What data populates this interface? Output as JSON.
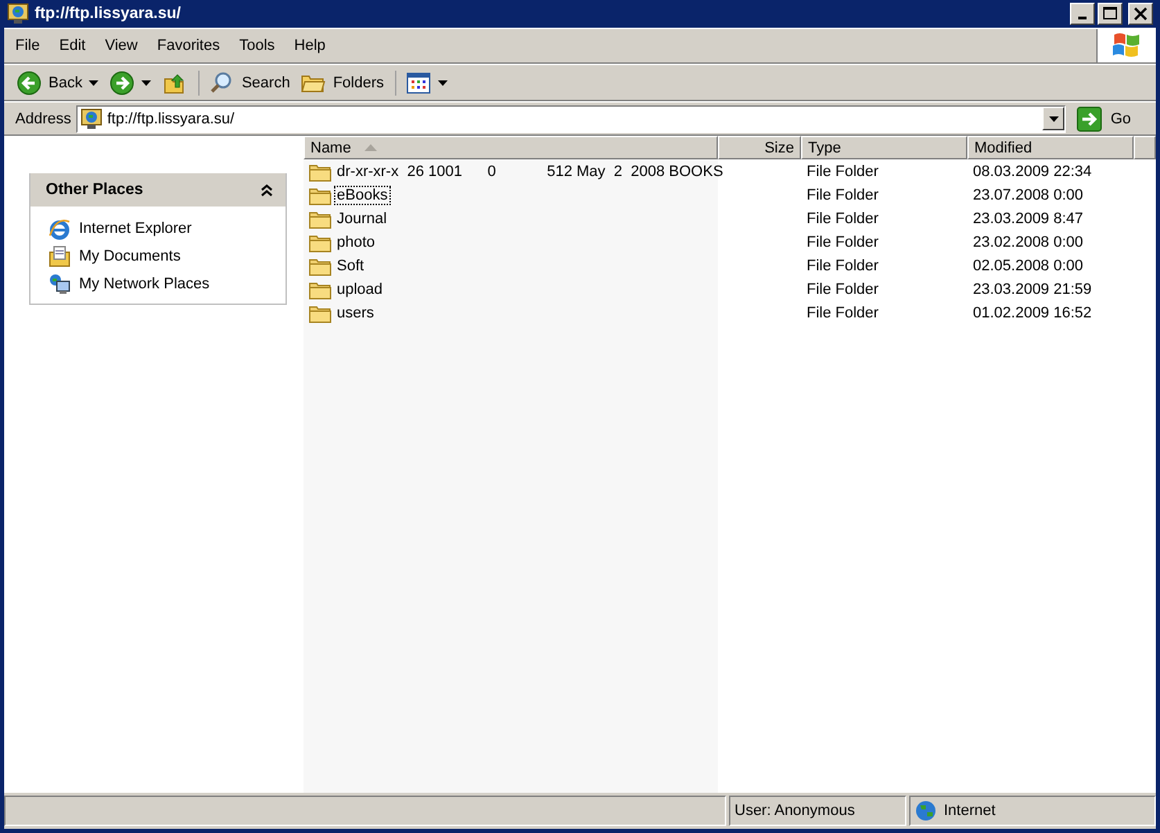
{
  "window": {
    "title": "ftp://ftp.lissyara.su/"
  },
  "menu": [
    "File",
    "Edit",
    "View",
    "Favorites",
    "Tools",
    "Help"
  ],
  "toolbar": [
    {
      "kind": "back",
      "label": "Back"
    },
    {
      "kind": "forward"
    },
    {
      "kind": "up"
    },
    {
      "kind": "search",
      "label": "Search"
    },
    {
      "kind": "folders",
      "label": "Folders"
    },
    {
      "kind": "views"
    }
  ],
  "address": {
    "label": "Address",
    "value": "ftp://ftp.lissyara.su/",
    "go": "Go"
  },
  "sidebar": {
    "title": "Other Places",
    "expanded": true,
    "items": [
      {
        "kind": "ie",
        "label": "Internet Explorer"
      },
      {
        "kind": "docs",
        "label": "My Documents"
      },
      {
        "kind": "network",
        "label": "My Network Places"
      }
    ]
  },
  "table": {
    "columns": [
      {
        "label": "Name",
        "sorted": true
      },
      {
        "label": "Size",
        "sorted": false
      },
      {
        "label": "Type",
        "sorted": false
      },
      {
        "label": "Modified",
        "sorted": false
      }
    ],
    "rows": [
      {
        "name": "dr-xr-xr-x  26 1001      0            512 May  2  2008 BOOKS",
        "type": "File Folder",
        "modified": "08.03.2009 22:34",
        "focused": false
      },
      {
        "name": "eBooks",
        "type": "File Folder",
        "modified": "23.07.2008 0:00",
        "focused": true
      },
      {
        "name": "Journal",
        "type": "File Folder",
        "modified": "23.03.2009 8:47",
        "focused": false
      },
      {
        "name": "photo",
        "type": "File Folder",
        "modified": "23.02.2008 0:00",
        "focused": false
      },
      {
        "name": "Soft",
        "type": "File Folder",
        "modified": "02.05.2008 0:00",
        "focused": false
      },
      {
        "name": "upload",
        "type": "File Folder",
        "modified": "23.03.2009 21:59",
        "focused": false
      },
      {
        "name": "users",
        "type": "File Folder",
        "modified": "01.02.2009 16:52",
        "focused": false
      }
    ]
  },
  "status_bar": {
    "user": "User: Anonymous",
    "zone": "Internet"
  }
}
